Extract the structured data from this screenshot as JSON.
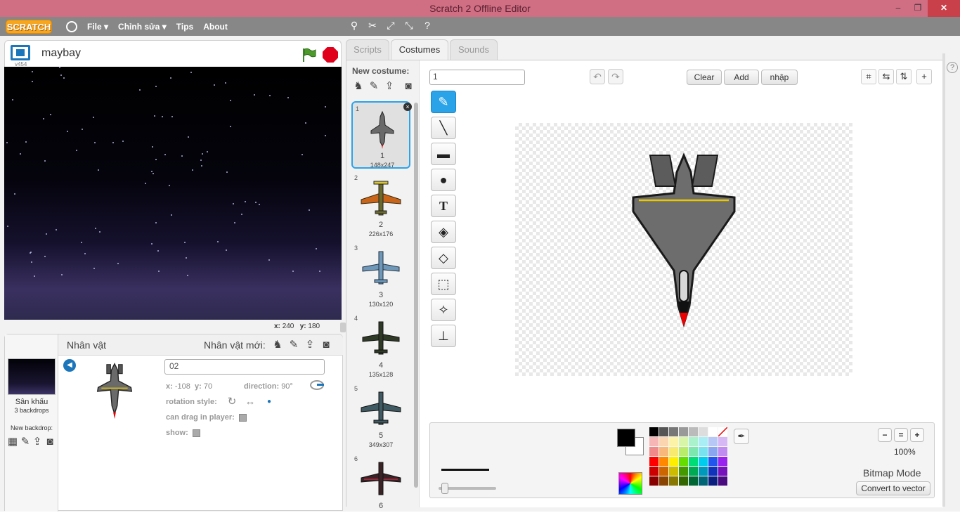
{
  "window": {
    "title": "Scratch 2 Offline Editor",
    "controls": [
      "–",
      "❐",
      "✕"
    ]
  },
  "menubar": {
    "logo": "SCRATCH",
    "items": [
      "File ▾",
      "Chỉnh sửa ▾",
      "Tips",
      "About"
    ]
  },
  "stage": {
    "version": "v454",
    "project_name": "maybay",
    "coords": {
      "x_label": "x:",
      "x": "240",
      "y_label": "y:",
      "y": "180"
    }
  },
  "sprites": {
    "title": "Nhân vật",
    "new_label": "Nhân vật mới:",
    "stage_name": "Sân khấu",
    "backdrops": "3 backdrops",
    "new_backdrop": "New backdrop:",
    "selected": {
      "name": "02",
      "x_label": "x:",
      "x": "-108",
      "y_label": "y:",
      "y": "70",
      "direction_label": "direction:",
      "direction": "90°",
      "rotation_label": "rotation style:",
      "drag_label": "can drag in player:",
      "show_label": "show:"
    }
  },
  "tabs": [
    "Scripts",
    "Costumes",
    "Sounds"
  ],
  "costumes": {
    "new_label": "New costume:",
    "items": [
      {
        "num": "1",
        "name": "1",
        "size": "148x247"
      },
      {
        "num": "2",
        "name": "2",
        "size": "226x176"
      },
      {
        "num": "3",
        "name": "3",
        "size": "130x120"
      },
      {
        "num": "4",
        "name": "4",
        "size": "135x128"
      },
      {
        "num": "5",
        "name": "5",
        "size": "349x307"
      },
      {
        "num": "6",
        "name": "6",
        "size": ""
      }
    ]
  },
  "paint": {
    "costume_name": "1",
    "clear": "Clear",
    "add": "Add",
    "import": "nhập",
    "zoom": "100%",
    "mode": "Bitmap Mode",
    "convert": "Convert to vector"
  },
  "palette": [
    "#000000",
    "#555555",
    "#777777",
    "#999999",
    "#bbbbbb",
    "#dddddd",
    "#ffffff",
    "#ffffff",
    "#f7b6b6",
    "#fbd5b0",
    "#fcf3a8",
    "#d8f5a8",
    "#aaf2cc",
    "#a8eef4",
    "#b8c8f6",
    "#d6b8f4",
    "#f08a8a",
    "#f8b87c",
    "#f8ea6e",
    "#b8ec6a",
    "#7ce8b0",
    "#78e2ee",
    "#8aa6f0",
    "#c08cf0",
    "#ff0000",
    "#ff8800",
    "#ffee00",
    "#66dd00",
    "#00dd77",
    "#00ccee",
    "#2255ee",
    "#9922ee",
    "#cc0000",
    "#cc6600",
    "#ccbb00",
    "#449900",
    "#00aa55",
    "#0099bb",
    "#1133bb",
    "#7711bb",
    "#880000",
    "#884400",
    "#887700",
    "#336600",
    "#006633",
    "#006677",
    "#0a1f80",
    "#4a0a80"
  ],
  "colors": {
    "accent": "#2ba3e8",
    "titlebar": "#d06f84",
    "menubar": "#878787",
    "stop": "#e0001b",
    "flag": "#3f8a2a"
  }
}
